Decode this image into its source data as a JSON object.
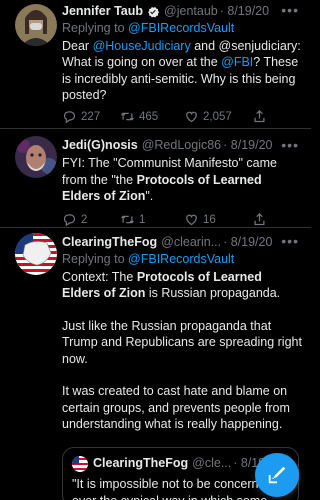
{
  "colors": {
    "background": "#000000",
    "accent": "#1d9bf0",
    "muted": "#71767b",
    "text": "#e7e9ea"
  },
  "tweets": [
    {
      "name": "Jennifer Taub",
      "handle": "@jentaub",
      "date": "· 8/19/20",
      "verified": true,
      "reply_prefix": "Replying to",
      "reply_to": "@FBIRecordsVault",
      "text": {
        "p1": "Dear ",
        "m1": "@HouseJudiciary",
        "p2": " and @senjudiciary: What is going on over at the ",
        "m2": "@FBI",
        "p3": "? These is incredibly anti-semitic. Why is this being posted?"
      },
      "stats": {
        "replies": "227",
        "retweets": "465",
        "likes": "2,057"
      }
    },
    {
      "name": "Jedi(G)nosis",
      "handle": "@RedLogic86",
      "date": "· 8/19/20",
      "text": {
        "p1": "FYI: The \"Communist Manifesto\" came from the \"the ",
        "b1": "Protocols of Learned Elders of Zion",
        "p2": "\"."
      },
      "stats": {
        "replies": "2",
        "retweets": "1",
        "likes": "16"
      }
    },
    {
      "name": "ClearingTheFog",
      "handle": "@clearin...",
      "date": "· 8/19/20",
      "reply_prefix": "Replying to",
      "reply_to": "@FBIRecordsVault",
      "text": {
        "p1": "Context: The ",
        "b1": "Protocols of Learned Elders of Zion",
        "p2": " is Russian propaganda.",
        "para2": "Just like the Russian propaganda that Trump and Republicans are spreading right now.",
        "para3": "It was created to cast hate and blame on certain groups, and prevents people from understanding what is really happening."
      },
      "quote": {
        "name": "ClearingTheFog",
        "handle": "@cle...",
        "date": "· 8/19/20",
        "text": "\"It is impossible not to be concerned over the cynical way in which some"
      }
    }
  ],
  "more_icon": "more-icon",
  "compose_icon": "compose-icon"
}
